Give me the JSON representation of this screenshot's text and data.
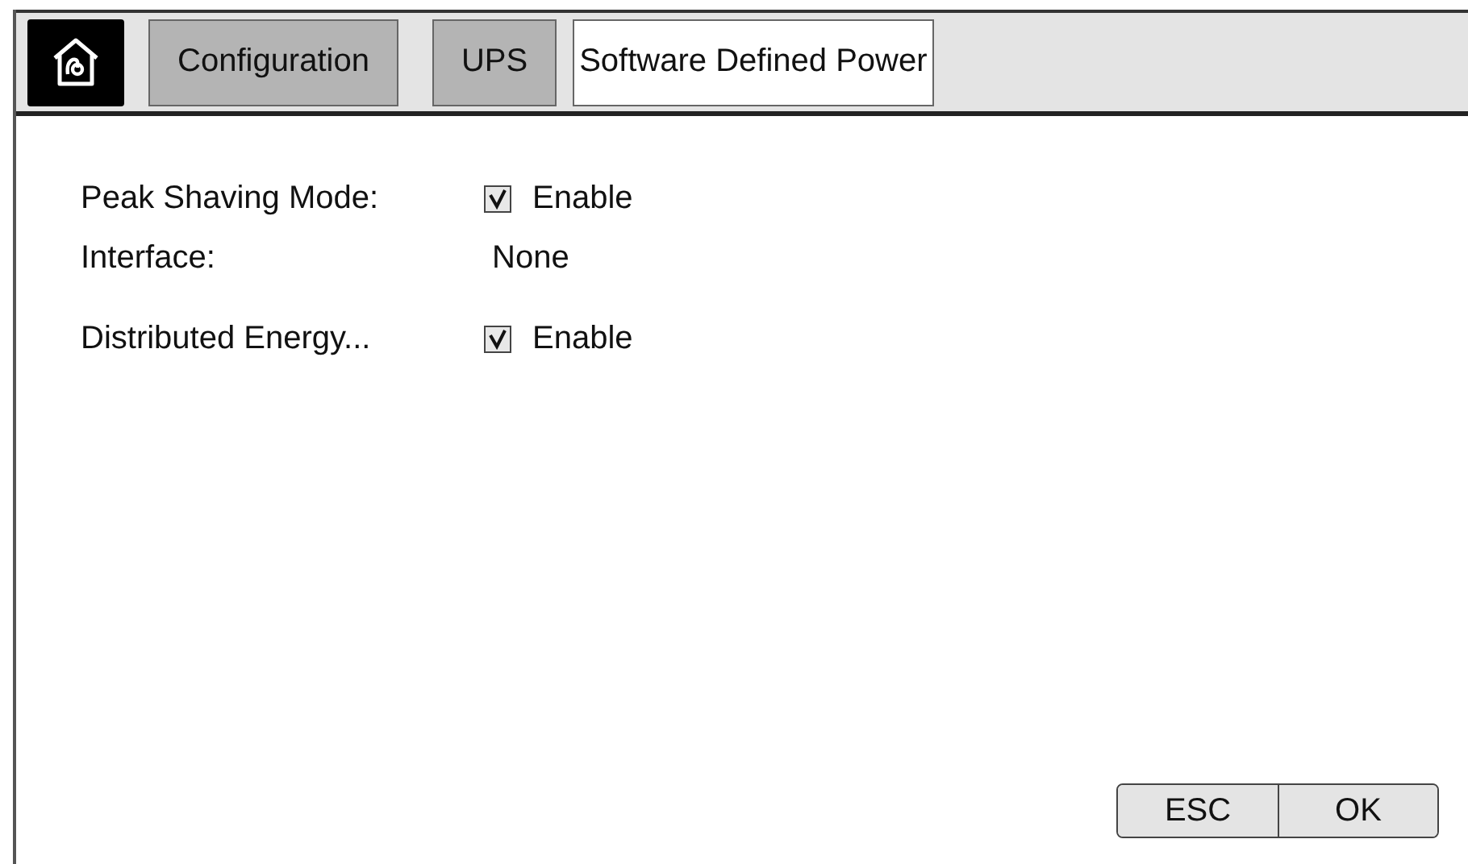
{
  "tabs": [
    {
      "label": "Configuration",
      "selected": false
    },
    {
      "label": "UPS",
      "selected": false
    },
    {
      "label": "Software Defined Power",
      "selected": true
    }
  ],
  "settings": [
    {
      "kind": "checkbox",
      "label": "Peak Shaving Mode:",
      "checked": true,
      "value": "Enable"
    },
    {
      "kind": "value",
      "label": "Interface:",
      "value": "None"
    },
    {
      "kind": "checkbox",
      "label": "Distributed Energy...",
      "checked": true,
      "value": "Enable"
    }
  ],
  "buttons": [
    "ESC",
    "OK"
  ]
}
